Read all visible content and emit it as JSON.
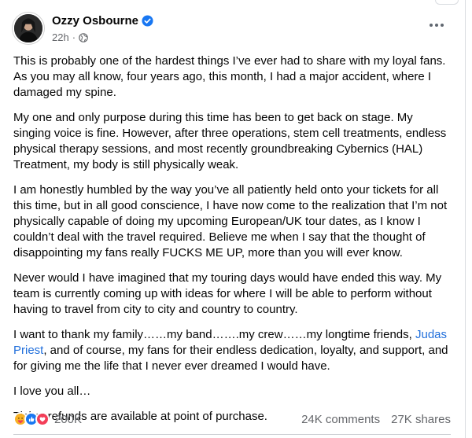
{
  "post": {
    "author": "Ozzy Osbourne",
    "time": "22h",
    "separator": "·",
    "paragraphs": [
      "This is probably one of the hardest things I’ve ever had to share with my loyal fans.  As you may all know, four years ago, this month, I had a major accident, where I damaged my spine.",
      "My one and only purpose during this time has been to get back on stage.  My singing voice is fine.  However, after three operations, stem cell treatments, endless physical therapy sessions, and most recently groundbreaking Cybernics (HAL) Treatment, my body is still physically weak.",
      "I am honestly humbled by the way you’ve all patiently held onto your tickets for all this time, but in all good conscience, I have now come to the realization that I’m not physically capable of doing my upcoming European/UK tour dates, as I know I couldn’t deal with the travel required.  Believe me when I say that the thought of disappointing my fans really FUCKS ME UP, more than you will ever know.",
      "Never would I have imagined that my touring days would have ended this way.  My team is currently coming up with ideas for where I will be able to perform without having to travel from city to city and country to country."
    ],
    "thanks_before": "I want to thank my family……my band…….my crew……my longtime friends, ",
    "thanks_link": "Judas Priest",
    "thanks_after": ", and of course, my fans for their endless dedication, loyalty, and support, and for giving me the life that I never ever dreamed I would have.",
    "love_line": "I love you all…",
    "refund_line": "Ticket refunds are available at point of purchase."
  },
  "footer": {
    "reaction_count": "200K",
    "comments": "24K comments",
    "shares": "27K shares"
  },
  "icons": {
    "verified": "verified-badge-icon",
    "audience": "globe-icon",
    "menu": "more-options-icon",
    "reactions": [
      "care-icon",
      "like-icon",
      "love-icon"
    ]
  },
  "colors": {
    "link": "#216fdb",
    "verified": "#1877f2",
    "like": "#1877f2",
    "love": "#f33e58",
    "care": "#f7b125",
    "secondary_text": "#65676b"
  }
}
